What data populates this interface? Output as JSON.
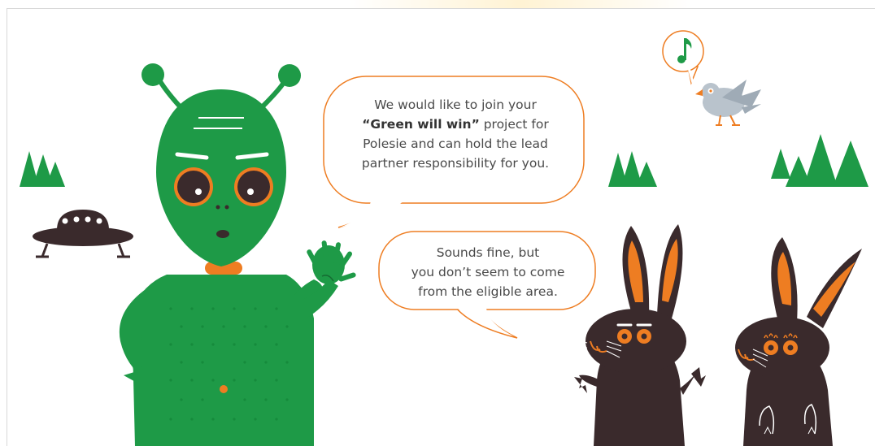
{
  "dialogue": {
    "alien_line": {
      "pre": "We would like to join your",
      "bold": "“Green will win”",
      "post1": " project for",
      "post2": "Polesie and can hold the lead",
      "post3": "partner responsibility for you."
    },
    "rabbit_line": {
      "line1": "Sounds fine, but",
      "line2": "you don’t seem to come",
      "line3": "from the eligible area."
    }
  },
  "colors": {
    "alien_green": "#1e9a47",
    "accent_orange": "#ee7d22",
    "rabbit_brown": "#3a2a2c",
    "bird_gray": "#b9c3cc"
  },
  "icons": [
    "music-note-icon",
    "ufo-icon",
    "tree-icon"
  ]
}
